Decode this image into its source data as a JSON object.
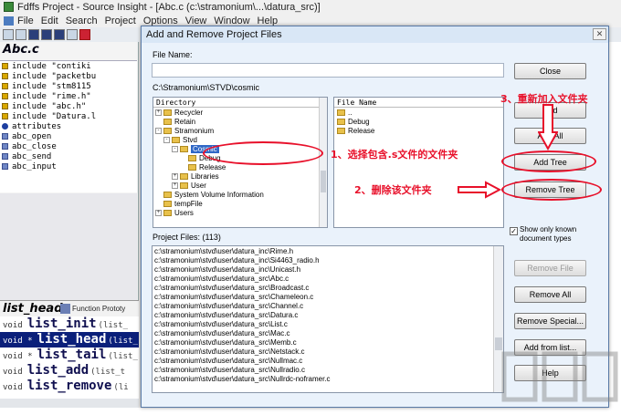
{
  "app": {
    "title": "Fdffs Project - Source Insight - [Abc.c (c:\\stramonium\\...\\datura_src)]",
    "menu": [
      "File",
      "Edit",
      "Search",
      "Project",
      "Options",
      "View",
      "Window",
      "Help"
    ]
  },
  "left_panel": {
    "file_title": "Abc.c",
    "symbols": [
      {
        "icon": "include-icon",
        "text": "include \"contiki"
      },
      {
        "icon": "include-icon",
        "text": "include \"packetbu"
      },
      {
        "icon": "include-icon",
        "text": "include \"stm8115"
      },
      {
        "icon": "include-icon",
        "text": "include \"rime.h\""
      },
      {
        "icon": "include-icon",
        "text": "include \"abc.h\""
      },
      {
        "icon": "include-icon",
        "text": "include \"Datura.l"
      },
      {
        "icon": "attribute-icon",
        "text": "attributes"
      },
      {
        "icon": "function-icon",
        "text": "abc_open"
      },
      {
        "icon": "function-icon",
        "text": "abc_close"
      },
      {
        "icon": "function-icon",
        "text": "abc_send"
      },
      {
        "icon": "function-icon",
        "text": "abc_input"
      }
    ]
  },
  "context": {
    "title": "list_head",
    "subtitle": "Function Prototy",
    "lines": [
      {
        "kw": "void",
        "name": "list_init",
        "args": "(list_",
        "selected": false
      },
      {
        "kw": "void *",
        "name": "list_head",
        "args": "(list_",
        "selected": true
      },
      {
        "kw": "void *",
        "name": "list_tail",
        "args": "(list_",
        "selected": false
      },
      {
        "kw": "void",
        "name": "list_add",
        "args": "(list_t",
        "selected": false
      },
      {
        "kw": "void",
        "name": "list_remove",
        "args": "(li",
        "selected": false
      }
    ]
  },
  "dialog": {
    "title": "Add and Remove Project Files",
    "file_name_label": "File Name:",
    "file_name_value": "",
    "current_path": "C:\\Stramonium\\STVD\\cosmic",
    "directory_header": "Directory",
    "file_name_header": "File Name",
    "directory_tree": [
      {
        "depth": 1,
        "expander": "+",
        "name": "Recycler",
        "selected": false
      },
      {
        "depth": 1,
        "expander": "",
        "name": "Retain",
        "selected": false
      },
      {
        "depth": 1,
        "expander": "-",
        "name": "Stramonium",
        "selected": false
      },
      {
        "depth": 2,
        "expander": "-",
        "name": "Stvd",
        "selected": false
      },
      {
        "depth": 3,
        "expander": "-",
        "name": "Cosmic",
        "selected": true
      },
      {
        "depth": 4,
        "expander": "",
        "name": "Debug",
        "selected": false
      },
      {
        "depth": 4,
        "expander": "",
        "name": "Release",
        "selected": false
      },
      {
        "depth": 3,
        "expander": "+",
        "name": "Libraries",
        "selected": false
      },
      {
        "depth": 3,
        "expander": "+",
        "name": "User",
        "selected": false
      },
      {
        "depth": 1,
        "expander": "",
        "name": "System Volume Information",
        "selected": false
      },
      {
        "depth": 1,
        "expander": "",
        "name": "tempFile",
        "selected": false
      },
      {
        "depth": 1,
        "expander": "+",
        "name": "Users",
        "selected": false
      }
    ],
    "file_entries": [
      {
        "name": "..",
        "folder": true
      },
      {
        "name": "Debug",
        "folder": true
      },
      {
        "name": "Release",
        "folder": true
      }
    ],
    "project_files_label": "Project Files: (113)",
    "project_files": [
      "c:\\stramonium\\stvd\\user\\datura_inc\\Rime.h",
      "c:\\stramonium\\stvd\\user\\datura_inc\\Si4463_radio.h",
      "c:\\stramonium\\stvd\\user\\datura_inc\\Unicast.h",
      "c:\\stramonium\\stvd\\user\\datura_src\\Abc.c",
      "c:\\stramonium\\stvd\\user\\datura_src\\Broadcast.c",
      "c:\\stramonium\\stvd\\user\\datura_src\\Chameleon.c",
      "c:\\stramonium\\stvd\\user\\datura_src\\Channel.c",
      "c:\\stramonium\\stvd\\user\\datura_src\\Datura.c",
      "c:\\stramonium\\stvd\\user\\datura_src\\List.c",
      "c:\\stramonium\\stvd\\user\\datura_src\\Mac.c",
      "c:\\stramonium\\stvd\\user\\datura_src\\Memb.c",
      "c:\\stramonium\\stvd\\user\\datura_src\\Netstack.c",
      "c:\\stramonium\\stvd\\user\\datura_src\\Nullmac.c",
      "c:\\stramonium\\stvd\\user\\datura_src\\Nullradio.c",
      "c:\\stramonium\\stvd\\user\\datura_src\\Nullrdc-noframer.c"
    ],
    "buttons": {
      "close": "Close",
      "add": "Add",
      "add_all": "Add All",
      "add_tree": "Add Tree",
      "remove_tree": "Remove Tree",
      "remove_file": "Remove File",
      "remove_all": "Remove All",
      "remove_special": "Remove Special...",
      "add_from_list": "Add from list...",
      "help": "Help"
    },
    "show_only_known": "Show only known document types",
    "show_only_known_checked": true
  },
  "annotations": {
    "step1": "1、选择包含.s文件的文件夹",
    "step2": "2、删除该文件夹",
    "step3": "3、重新加入文件夹",
    "color": "#e8102a"
  }
}
